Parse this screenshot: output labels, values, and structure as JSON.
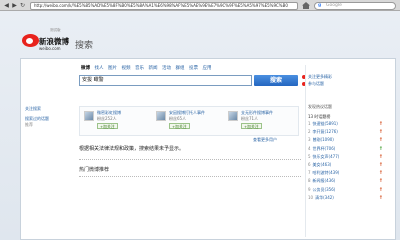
{
  "browser": {
    "back": "◀",
    "forward": "▶",
    "reload": "↻",
    "url": "http://weibo.com/k/%E5%85%AD%E5%8F%B0%E5%8A%A1%E6%98%AF%E5%AE%9E%E7%9C%9F%E5%A5%97%E5%9C%B0",
    "search_placeholder": "Google",
    "search_engine_glyph": "g"
  },
  "logo": {
    "beta": "测试版",
    "brand": "新浪微博",
    "url": "weibo.com",
    "color": "#e8231d"
  },
  "page_title": "搜索",
  "search": {
    "tabs": [
      "微博",
      "找人",
      "图片",
      "视频",
      "音乐",
      "新闻",
      "活动",
      "群组",
      "投票",
      "应用"
    ],
    "active_tab": 0,
    "query": "安拔 瞰警",
    "button": "搜索"
  },
  "right_links": [
    "关注更多精彩",
    "参与话题"
  ],
  "left_nav": [
    "关注搜索",
    "搜索过的话题",
    "推荐"
  ],
  "recommendations": [
    {
      "name": "微密彩虹搜博",
      "fans": "粉丝252人",
      "follow": "+加关注"
    },
    {
      "name": "安因搜博打托人事件",
      "fans": "粉丝65人",
      "follow": "+加关注"
    },
    {
      "name": "支无形件搜博事件",
      "fans": "粉丝71人",
      "follow": "+加关注"
    }
  ],
  "more_people": "查看更多用户",
  "notice": "根据相关法律法规和政策，搜索结果未予显示。",
  "hot_title": "热门微博推荐",
  "trends": {
    "header": "发现热议话题",
    "subheader": "13 时话题榜",
    "items": [
      {
        "rank": "1",
        "text": "快速链(5891)"
      },
      {
        "rank": "2",
        "text": "李开复(1276)"
      },
      {
        "rank": "3",
        "text": "曾刚(1090)"
      },
      {
        "rank": "4",
        "text": "世界杯(706)"
      },
      {
        "rank": "5",
        "text": "快乐女声(477)"
      },
      {
        "rank": "6",
        "text": "美女(463)"
      },
      {
        "rank": "7",
        "text": "哈利波特(439)"
      },
      {
        "rank": "8",
        "text": "新闻报(436)"
      },
      {
        "rank": "9",
        "text": "公务员(356)"
      },
      {
        "rank": "10",
        "text": "清华(342)"
      }
    ],
    "up_color": "#d24a1a",
    "flat_color": "#3a9a2a"
  }
}
